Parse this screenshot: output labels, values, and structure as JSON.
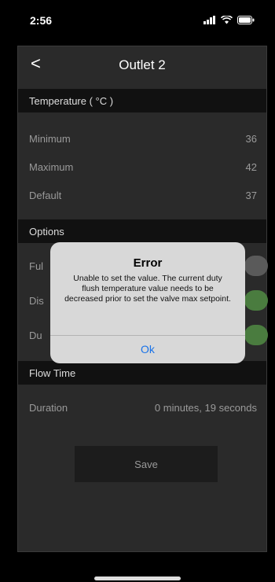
{
  "status": {
    "time": "2:56"
  },
  "nav": {
    "back_label": "<",
    "title": "Outlet 2"
  },
  "temperature": {
    "header": "Temperature ( °C )",
    "rows": [
      {
        "label": "Minimum",
        "value": "36"
      },
      {
        "label": "Maximum",
        "value": "42"
      },
      {
        "label": "Default",
        "value": "37"
      }
    ]
  },
  "options": {
    "header": "Options",
    "rows": [
      {
        "label": "Ful",
        "on": false
      },
      {
        "label": "Dis",
        "on": true
      },
      {
        "label": "Du",
        "on": true
      }
    ]
  },
  "flow_time": {
    "header": "Flow Time",
    "duration_label": "Duration",
    "duration_value": "0 minutes, 19 seconds"
  },
  "save_label": "Save",
  "alert": {
    "title": "Error",
    "message": "Unable to set the value. The current duty flush temperature value needs to be decreased prior to set the valve max setpoint.",
    "ok_label": "Ok"
  },
  "colors": {
    "toggle_on": "#4a7c3f",
    "toggle_off": "#5a5a5a",
    "link_blue": "#1a73e8"
  }
}
